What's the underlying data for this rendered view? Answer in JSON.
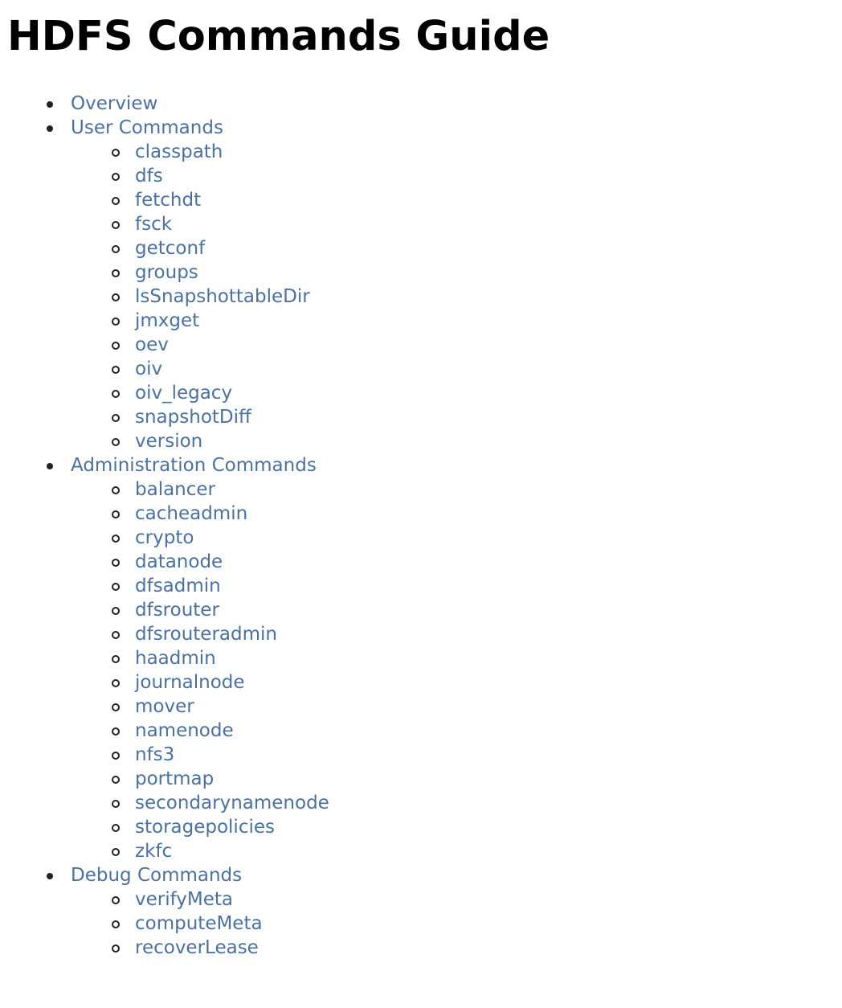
{
  "page": {
    "title": "HDFS Commands Guide",
    "link_color": "#4a71a3"
  },
  "toc": {
    "overview": {
      "label": "Overview"
    },
    "user_commands": {
      "label": "User Commands",
      "items": [
        {
          "label": "classpath"
        },
        {
          "label": "dfs"
        },
        {
          "label": "fetchdt"
        },
        {
          "label": "fsck"
        },
        {
          "label": "getconf"
        },
        {
          "label": "groups"
        },
        {
          "label": "lsSnapshottableDir"
        },
        {
          "label": "jmxget"
        },
        {
          "label": "oev"
        },
        {
          "label": "oiv"
        },
        {
          "label": "oiv_legacy"
        },
        {
          "label": "snapshotDiff"
        },
        {
          "label": "version"
        }
      ]
    },
    "administration_commands": {
      "label": "Administration Commands",
      "items": [
        {
          "label": "balancer"
        },
        {
          "label": "cacheadmin"
        },
        {
          "label": "crypto"
        },
        {
          "label": "datanode"
        },
        {
          "label": "dfsadmin"
        },
        {
          "label": "dfsrouter"
        },
        {
          "label": "dfsrouteradmin"
        },
        {
          "label": "haadmin"
        },
        {
          "label": "journalnode"
        },
        {
          "label": "mover"
        },
        {
          "label": "namenode"
        },
        {
          "label": "nfs3"
        },
        {
          "label": "portmap"
        },
        {
          "label": "secondarynamenode"
        },
        {
          "label": "storagepolicies"
        },
        {
          "label": "zkfc"
        }
      ]
    },
    "debug_commands": {
      "label": "Debug Commands",
      "items": [
        {
          "label": "verifyMeta"
        },
        {
          "label": "computeMeta"
        },
        {
          "label": "recoverLease"
        }
      ]
    }
  }
}
